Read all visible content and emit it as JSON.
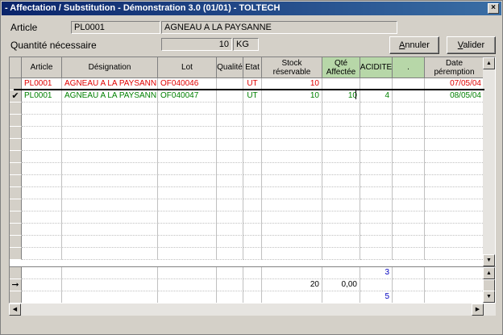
{
  "window": {
    "title": "- Affectation / Substitution - Démonstration 3.0 (01/01) - TOLTECH",
    "close_glyph": "×"
  },
  "form": {
    "article_label": "Article",
    "article_code": "PL0001",
    "article_name": "AGNEAU A LA PAYSANNE",
    "qty_label": "Quantité nécessaire",
    "qty_value": "10",
    "qty_unit": "KG",
    "cancel_label": "Annuler",
    "cancel_hotkey": "A",
    "cancel_rest": "nnuler",
    "ok_hotkey": "V",
    "ok_rest": "alider"
  },
  "grid": {
    "columns": [
      "Article",
      "Désignation",
      "Lot",
      "Qualité",
      "Etat",
      "Stock réservable",
      "Qté Affectée",
      "ACIDITE",
      ".",
      "Date péremption"
    ],
    "rows": [
      {
        "marker": "",
        "color": "red",
        "article": "PL0001",
        "designation": "AGNEAU A LA PAYSANNE",
        "lot": "OF040046",
        "qualite": "",
        "etat": "UT",
        "stock": "10",
        "qte": "",
        "acidite": "",
        "dot": "",
        "date": "07/05/04"
      },
      {
        "marker": "✔",
        "color": "grn",
        "article": "PL0001",
        "designation": "AGNEAU A LA PAYSANNE",
        "lot": "OF040047",
        "qualite": "",
        "etat": "UT",
        "stock": "10",
        "qte": "10",
        "acidite": "4",
        "dot": "",
        "date": "08/05/04"
      }
    ]
  },
  "summary": {
    "rows": [
      {
        "marker": "",
        "stock": "",
        "qte": "",
        "acidite": "3"
      },
      {
        "marker": "➞",
        "stock": "20",
        "qte": "0,00",
        "acidite": ""
      },
      {
        "marker": "",
        "stock": "",
        "qte": "",
        "acidite": "5"
      }
    ]
  },
  "icons": {
    "scroll_up": "▲",
    "scroll_down": "▼",
    "scroll_left": "◀",
    "scroll_right": "▶"
  }
}
